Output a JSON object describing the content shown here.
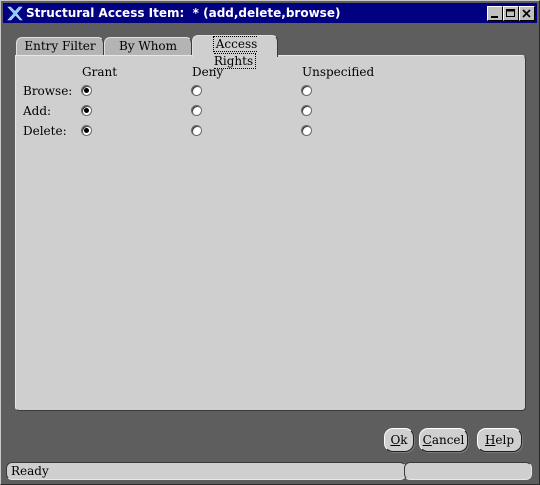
{
  "window": {
    "title": "Structural Access Item:  * (add,delete,browse)"
  },
  "tabs": [
    {
      "label": "Entry Filter",
      "active": false
    },
    {
      "label": "By Whom",
      "active": false
    },
    {
      "label": "Access Rights",
      "active": true
    }
  ],
  "access_rights": {
    "columns": [
      "Grant",
      "Deny",
      "Unspecified"
    ],
    "rows": [
      {
        "label": "Browse:",
        "selected": "Grant"
      },
      {
        "label": "Add:",
        "selected": "Grant"
      },
      {
        "label": "Delete:",
        "selected": "Grant"
      }
    ]
  },
  "buttons": {
    "ok": {
      "mnemonic": "O",
      "rest": "k"
    },
    "cancel": {
      "mnemonic": "C",
      "rest": "ancel"
    },
    "help": {
      "mnemonic": "H",
      "rest": "elp"
    }
  },
  "status": {
    "text": "Ready",
    "secondary": ""
  },
  "colors": {
    "titlebar": "#000080",
    "panel": "#cfcfcf",
    "frame": "#5e5e5e"
  }
}
